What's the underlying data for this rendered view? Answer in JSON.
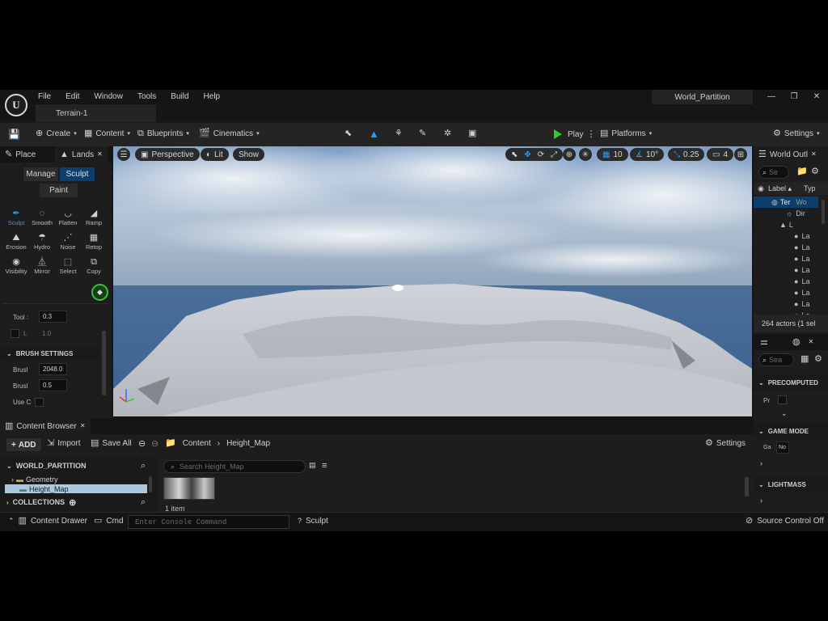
{
  "menu": [
    "File",
    "Edit",
    "Window",
    "Tools",
    "Build",
    "Help"
  ],
  "doc_tab": "Terrain-1",
  "project_name": "World_Partition",
  "window_controls": [
    "—",
    "❐",
    "✕"
  ],
  "toolbar": {
    "create": "Create",
    "content": "Content",
    "blueprints": "Blueprints",
    "cinematics": "Cinematics",
    "play": "Play",
    "platforms": "Platforms",
    "settings": "Settings"
  },
  "left_panel": {
    "tab_place": "Place",
    "tab_landscape": "Lands",
    "mode_manage": "Manage",
    "mode_sculpt": "Sculpt",
    "mode_paint": "Paint",
    "tools_row1": [
      "Sculpt",
      "Smooth",
      "Flatten",
      "Ramp"
    ],
    "tools_row2": [
      "Erosion",
      "Hydro",
      "Noise",
      "Retop"
    ],
    "tools_row3": [
      "Visibility",
      "Mirror",
      "Select",
      "Copy"
    ],
    "tool_label": "Tool :",
    "tool_value": "0.3",
    "l_label": "L",
    "l_value": "1.0",
    "brush_settings": "BRUSH SETTINGS",
    "brush_size_label": "Brusl",
    "brush_size_value": "2048.0",
    "brush_falloff_label": "Brusl",
    "brush_falloff_value": "0.5",
    "use_label": "Use C"
  },
  "viewport": {
    "perspective": "Perspective",
    "lit": "Lit",
    "show": "Show",
    "grid_snap": "10",
    "rot_snap": "10°",
    "scale_snap": "0.25",
    "camera_speed": "4"
  },
  "outliner": {
    "title": "World Outl",
    "search_placeholder": "Se",
    "col_label": "Label ▴",
    "col_type": "Typ",
    "row_world": "Ter",
    "row_world_type": "Wo",
    "row_dir": "Dir",
    "row_l": "L",
    "row_la": "La",
    "actor_count": "264 actors (1 sel"
  },
  "details": {
    "search_placeholder": "Sea",
    "precomputed": "PRECOMPUTED",
    "pr": "Pr",
    "game_mode": "GAME MODE",
    "ga": "Ga",
    "ga_value": "No",
    "lightmass": "LIGHTMASS"
  },
  "content_browser": {
    "tab": "Content Browser",
    "add": "ADD",
    "import": "Import",
    "save_all": "Save All",
    "crumb_content": "Content",
    "crumb_folder": "Height_Map",
    "settings": "Settings",
    "tree_root": "WORLD_PARTITION",
    "folder_geometry": "Geometry",
    "folder_heightmap": "Height_Map",
    "collections": "COLLECTIONS",
    "search_placeholder": "Search Height_Map",
    "item_count": "1 item"
  },
  "status": {
    "content_drawer": "Content Drawer",
    "cmd": "Cmd",
    "console_placeholder": "Enter Console Command",
    "mode": "Sculpt",
    "source_control": "Source Control Off"
  }
}
